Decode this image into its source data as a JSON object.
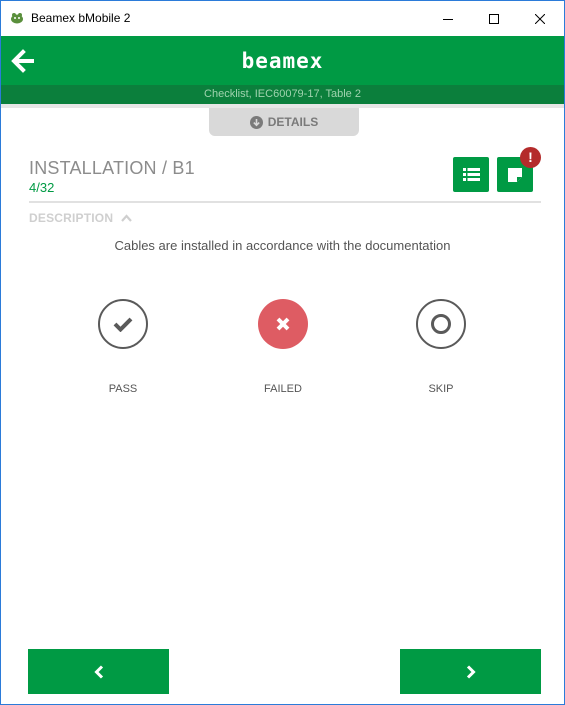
{
  "window": {
    "title": "Beamex bMobile 2"
  },
  "header": {
    "logo_text": "beamex",
    "subtitle": "Checklist, IEC60079-17, Table 2",
    "brand_color": "#009a44"
  },
  "details_tab": {
    "label": "DETAILS"
  },
  "section": {
    "title": "INSTALLATION / B1",
    "progress_current": "4",
    "progress_total": "/32",
    "alert_badge": "!"
  },
  "description": {
    "header": "DESCRIPTION",
    "text": "Cables are installed in accordance with the documentation"
  },
  "options": [
    {
      "label": "PASS",
      "icon": "check-icon"
    },
    {
      "label": "FAILED",
      "icon": "x-icon",
      "selected": true,
      "color": "#de5c63"
    },
    {
      "label": "SKIP",
      "icon": "ring-icon"
    }
  ],
  "navigation": {
    "prev_icon": "chevron-left-icon",
    "next_icon": "chevron-right-icon"
  }
}
